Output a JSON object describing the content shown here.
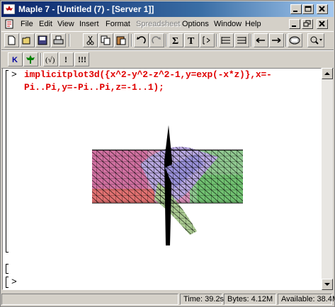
{
  "window": {
    "title": "Maple 7 - [Untitled (7) - [Server 1]]"
  },
  "menu": [
    {
      "label": "File",
      "disabled": false
    },
    {
      "label": "Edit",
      "disabled": false
    },
    {
      "label": "View",
      "disabled": false
    },
    {
      "label": "Insert",
      "disabled": false
    },
    {
      "label": "Format",
      "disabled": false
    },
    {
      "label": "Spreadsheet",
      "disabled": true
    },
    {
      "label": "Options",
      "disabled": false
    },
    {
      "label": "Window",
      "disabled": false
    },
    {
      "label": "Help",
      "disabled": false
    }
  ],
  "toolbar2": {
    "k_label": "K",
    "paren_label": "(√)",
    "excl_label": "!",
    "excl3_label": "!!!"
  },
  "worksheet": {
    "prompt": ">",
    "command_line1": "implicitplot3d({x^2-y^2-z^2-1,y=exp(-x*z)},x=-",
    "command_line2": "Pi..Pi,y=-Pi..Pi,z=-1..1);",
    "empty_prompt": ">"
  },
  "status": {
    "time": "Time: 39.2s",
    "bytes": "Bytes: 4.12M",
    "available": "Available: 38.4M"
  },
  "colors": {
    "command": "#e00000",
    "titlebar_start": "#0a246a"
  }
}
